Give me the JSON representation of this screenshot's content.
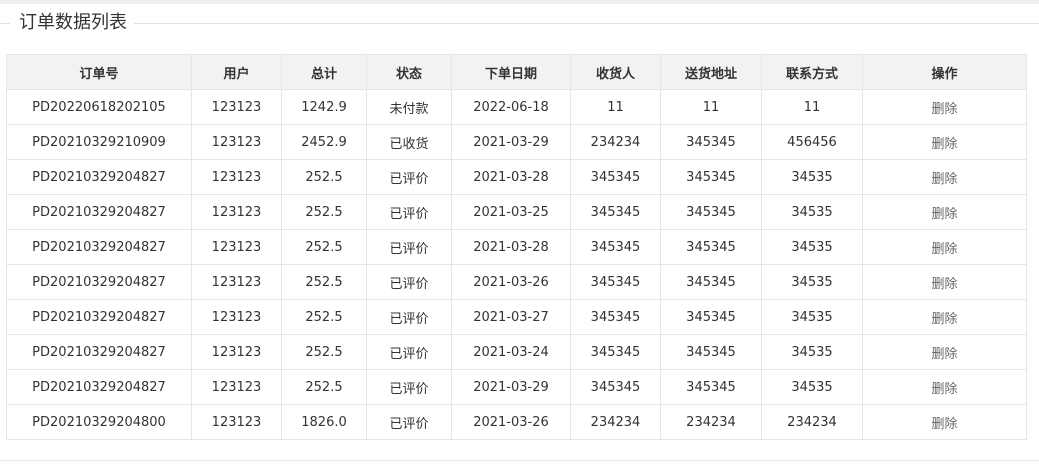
{
  "title": "订单数据列表",
  "columns": [
    "订单号",
    "用户",
    "总计",
    "状态",
    "下单日期",
    "收货人",
    "送货地址",
    "联系方式",
    "操作"
  ],
  "rows": [
    {
      "order_no": "PD20220618202105",
      "user": "123123",
      "total": "1242.9",
      "status": "未付款",
      "date": "2022-06-18",
      "consignee": "11",
      "address": "11",
      "contact": "11",
      "action": "删除"
    },
    {
      "order_no": "PD20210329210909",
      "user": "123123",
      "total": "2452.9",
      "status": "已收货",
      "date": "2021-03-29",
      "consignee": "234234",
      "address": "345345",
      "contact": "456456",
      "action": "删除"
    },
    {
      "order_no": "PD20210329204827",
      "user": "123123",
      "total": "252.5",
      "status": "已评价",
      "date": "2021-03-28",
      "consignee": "345345",
      "address": "345345",
      "contact": "34535",
      "action": "删除"
    },
    {
      "order_no": "PD20210329204827",
      "user": "123123",
      "total": "252.5",
      "status": "已评价",
      "date": "2021-03-25",
      "consignee": "345345",
      "address": "345345",
      "contact": "34535",
      "action": "删除"
    },
    {
      "order_no": "PD20210329204827",
      "user": "123123",
      "total": "252.5",
      "status": "已评价",
      "date": "2021-03-28",
      "consignee": "345345",
      "address": "345345",
      "contact": "34535",
      "action": "删除"
    },
    {
      "order_no": "PD20210329204827",
      "user": "123123",
      "total": "252.5",
      "status": "已评价",
      "date": "2021-03-26",
      "consignee": "345345",
      "address": "345345",
      "contact": "34535",
      "action": "删除"
    },
    {
      "order_no": "PD20210329204827",
      "user": "123123",
      "total": "252.5",
      "status": "已评价",
      "date": "2021-03-27",
      "consignee": "345345",
      "address": "345345",
      "contact": "34535",
      "action": "删除"
    },
    {
      "order_no": "PD20210329204827",
      "user": "123123",
      "total": "252.5",
      "status": "已评价",
      "date": "2021-03-24",
      "consignee": "345345",
      "address": "345345",
      "contact": "34535",
      "action": "删除"
    },
    {
      "order_no": "PD20210329204827",
      "user": "123123",
      "total": "252.5",
      "status": "已评价",
      "date": "2021-03-29",
      "consignee": "345345",
      "address": "345345",
      "contact": "34535",
      "action": "删除"
    },
    {
      "order_no": "PD20210329204800",
      "user": "123123",
      "total": "1826.0",
      "status": "已评价",
      "date": "2021-03-26",
      "consignee": "234234",
      "address": "234234",
      "contact": "234234",
      "action": "删除"
    }
  ]
}
